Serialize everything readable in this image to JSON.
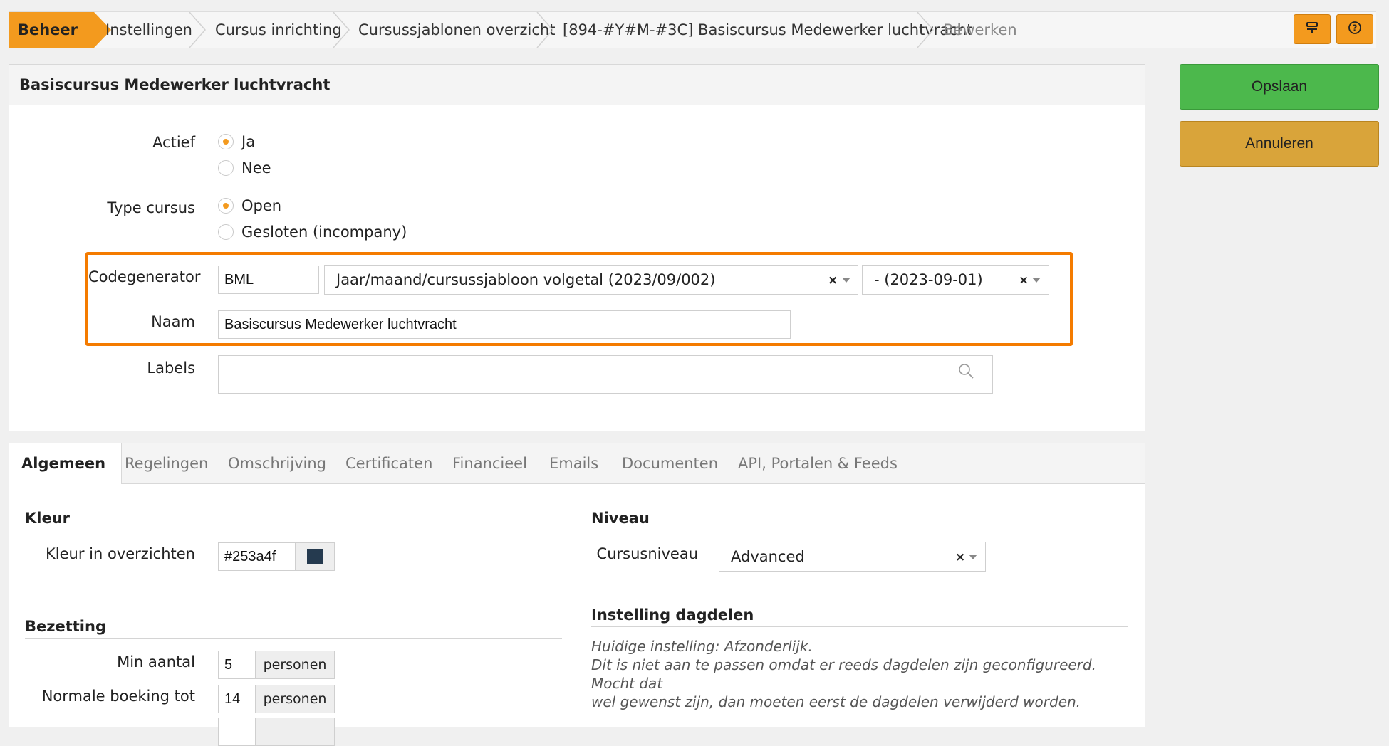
{
  "breadcrumb": {
    "items": [
      "Beheer",
      "Instellingen",
      "Cursus inrichting",
      "Cursussjablonen overzicht",
      "[894-#Y#M-#3C] Basiscursus Medewerker luchtvracht",
      "Bewerken"
    ]
  },
  "toolbar": {
    "icon1": "list-icon",
    "icon2": "help-icon"
  },
  "actions": {
    "save": "Opslaan",
    "cancel": "Annuleren"
  },
  "header": {
    "title": "Basiscursus Medewerker luchtvracht"
  },
  "form": {
    "actief": {
      "label": "Actief",
      "options": [
        "Ja",
        "Nee"
      ],
      "selected": "Ja"
    },
    "type": {
      "label": "Type cursus",
      "options": [
        "Open",
        "Gesloten (incompany)"
      ],
      "selected": "Open"
    },
    "codegenerator": {
      "label": "Codegenerator",
      "prefix": "BML",
      "pattern": "Jaar/maand/cursussjabloon volgetal (2023/09/002)",
      "date": "- (2023-09-01)"
    },
    "naam": {
      "label": "Naam",
      "value": "Basiscursus Medewerker luchtvracht"
    },
    "labels": {
      "label": "Labels",
      "value": ""
    }
  },
  "tabs": [
    "Algemeen",
    "Regelingen",
    "Omschrijving",
    "Certificaten",
    "Financieel",
    "Emails",
    "Documenten",
    "API, Portalen & Feeds"
  ],
  "algemeen": {
    "kleur": {
      "heading": "Kleur",
      "label": "Kleur in overzichten",
      "value": "#253a4f",
      "swatch": "#253a4f"
    },
    "bezetting": {
      "heading": "Bezetting",
      "min": {
        "label": "Min aantal",
        "value": "5",
        "unit": "personen"
      },
      "normaal": {
        "label": "Normale boeking tot",
        "value": "14",
        "unit": "personen"
      }
    },
    "niveau": {
      "heading": "Niveau",
      "label": "Cursusniveau",
      "value": "Advanced"
    },
    "dagdelen": {
      "heading": "Instelling dagdelen",
      "line1": "Huidige instelling: Afzonderlijk.",
      "line2": "Dit is niet aan te passen omdat er reeds dagdelen zijn geconfigureerd. Mocht dat",
      "line3": "wel gewenst zijn, dan moeten eerst de dagdelen verwijderd worden."
    }
  },
  "colors": {
    "accent": "#f39a1e",
    "highlight": "#f47b00",
    "save": "#4cb84c",
    "cancel": "#d9a43a"
  }
}
